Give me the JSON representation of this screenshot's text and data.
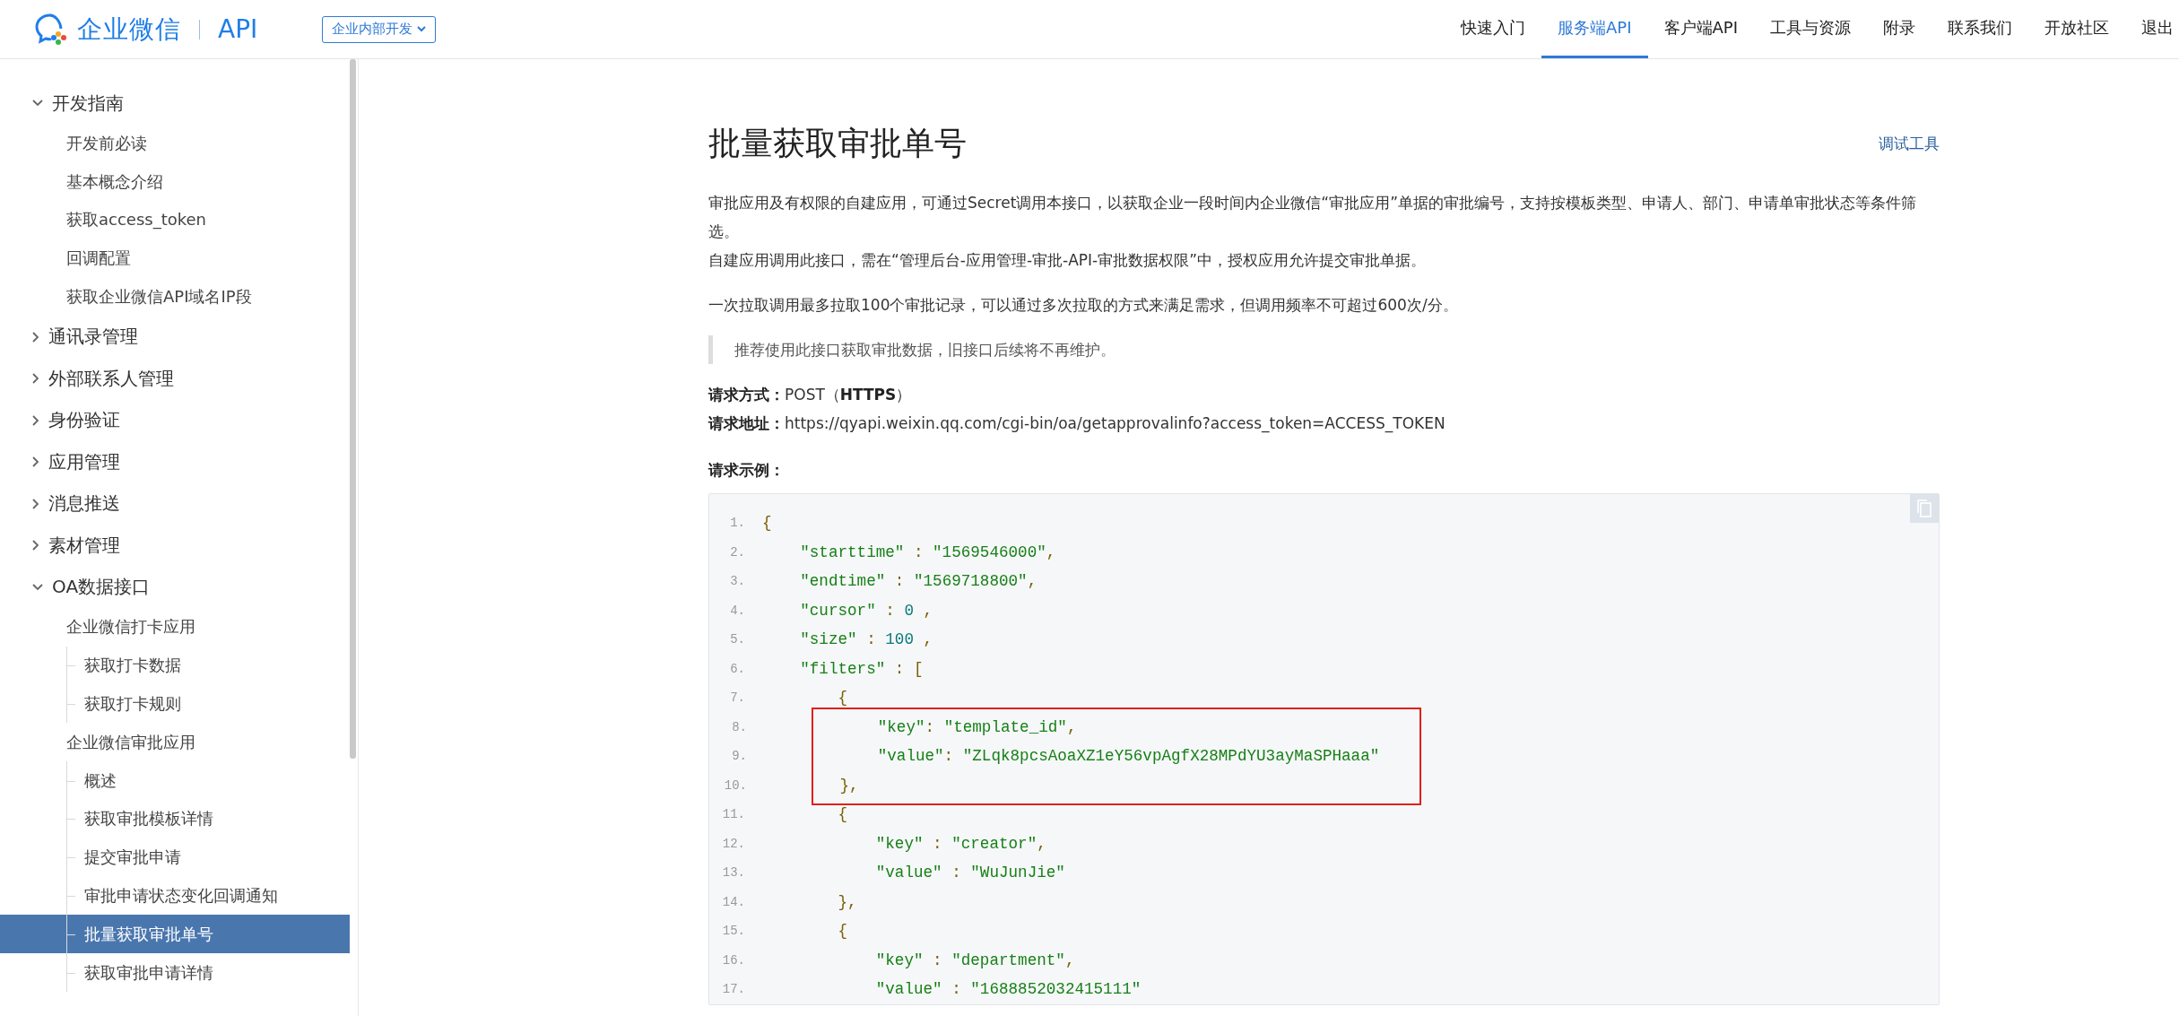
{
  "header": {
    "logo_text": "企业微信",
    "product": "API",
    "dropdown": "企业内部开发",
    "nav": [
      {
        "label": "快速入门",
        "selected": false
      },
      {
        "label": "服务端API",
        "selected": true
      },
      {
        "label": "客户端API",
        "selected": false
      },
      {
        "label": "工具与资源",
        "selected": false
      },
      {
        "label": "附录",
        "selected": false
      },
      {
        "label": "联系我们",
        "selected": false
      },
      {
        "label": "开放社区",
        "selected": false
      },
      {
        "label": "退出",
        "selected": false
      }
    ]
  },
  "sidebar": {
    "items": [
      {
        "label": "开发指南",
        "expanded": true,
        "children": [
          {
            "label": "开发前必读",
            "selected": false
          },
          {
            "label": "基本概念介绍",
            "selected": false
          },
          {
            "label": "获取access_token",
            "selected": false
          },
          {
            "label": "回调配置",
            "selected": false
          },
          {
            "label": "获取企业微信API域名IP段",
            "selected": false
          }
        ]
      },
      {
        "label": "通讯录管理",
        "expanded": false
      },
      {
        "label": "外部联系人管理",
        "expanded": false
      },
      {
        "label": "身份验证",
        "expanded": false
      },
      {
        "label": "应用管理",
        "expanded": false
      },
      {
        "label": "消息推送",
        "expanded": false
      },
      {
        "label": "素材管理",
        "expanded": false
      },
      {
        "label": "OA数据接口",
        "expanded": true,
        "children": [
          {
            "label": "企业微信打卡应用",
            "children": [
              {
                "label": "获取打卡数据",
                "selected": false
              },
              {
                "label": "获取打卡规则",
                "selected": false
              }
            ]
          },
          {
            "label": "企业微信审批应用",
            "children": [
              {
                "label": "概述",
                "selected": false
              },
              {
                "label": "获取审批模板详情",
                "selected": false
              },
              {
                "label": "提交审批申请",
                "selected": false
              },
              {
                "label": "审批申请状态变化回调通知",
                "selected": false
              },
              {
                "label": "批量获取审批单号",
                "selected": true
              },
              {
                "label": "获取审批申请详情",
                "selected": false
              }
            ]
          }
        ]
      }
    ]
  },
  "article": {
    "title": "批量获取审批单号",
    "tool_link": "调试工具",
    "paragraphs": [
      [
        "审批应用及有权限的自建应用，可通过Secret调用本接口，以获取企业一段时间内企业微信“审批应用”单据的审批编号，支持按模板类型、申请人、部门、申请单审批状态等条件筛选。",
        "自建应用调用此接口，需在“管理后台-应用管理-审批-API-审批数据权限”中，授权应用允许提交审批单据。"
      ],
      [
        "一次拉取调用最多拉取100个审批记录，可以通过多次拉取的方式来满足需求，但调用频率不可超过600次/分。"
      ]
    ],
    "note": "推荐使用此接口获取审批数据，旧接口后续将不再维护。",
    "request_method": {
      "label": "请求方式：",
      "value": "POST（**HTTPS**）"
    },
    "request_url": {
      "label": "请求地址：",
      "value": "https://qyapi.weixin.qq.com/cgi-bin/oa/getapprovalinfo?access_token=ACCESS_TOKEN"
    },
    "example_label": "请求示例：",
    "code": [
      {
        "number": "1.",
        "text": "{",
        "highlighted": false
      },
      {
        "number": "2.",
        "text": "    \"starttime\" : \"1569546000\",",
        "highlighted": false
      },
      {
        "number": "3.",
        "text": "    \"endtime\" : \"1569718800\",",
        "highlighted": false
      },
      {
        "number": "4.",
        "text": "    \"cursor\" : 0 ,",
        "highlighted": false
      },
      {
        "number": "5.",
        "text": "    \"size\" : 100 ,",
        "highlighted": false
      },
      {
        "number": "6.",
        "text": "    \"filters\" : [",
        "highlighted": false
      },
      {
        "number": "7.",
        "text": "        {",
        "highlighted": false
      },
      {
        "number": "8.",
        "text": "            \"key\": \"template_id\",",
        "highlighted": true
      },
      {
        "number": "9.",
        "text": "            \"value\": \"ZLqk8pcsAoaXZ1eY56vpAgfX28MPdYU3ayMaSPHaaa\"",
        "highlighted": true
      },
      {
        "number": "10.",
        "text": "        },",
        "highlighted": true
      },
      {
        "number": "11.",
        "text": "        {",
        "highlighted": false
      },
      {
        "number": "12.",
        "text": "            \"key\" : \"creator\",",
        "highlighted": false
      },
      {
        "number": "13.",
        "text": "            \"value\" : \"WuJunJie\"",
        "highlighted": false
      },
      {
        "number": "14.",
        "text": "        },",
        "highlighted": false
      },
      {
        "number": "15.",
        "text": "        {",
        "highlighted": false
      },
      {
        "number": "16.",
        "text": "            \"key\" : \"department\",",
        "highlighted": false
      },
      {
        "number": "17.",
        "text": "            \"value\" : \"1688852032415111\"",
        "highlighted": false
      }
    ]
  }
}
